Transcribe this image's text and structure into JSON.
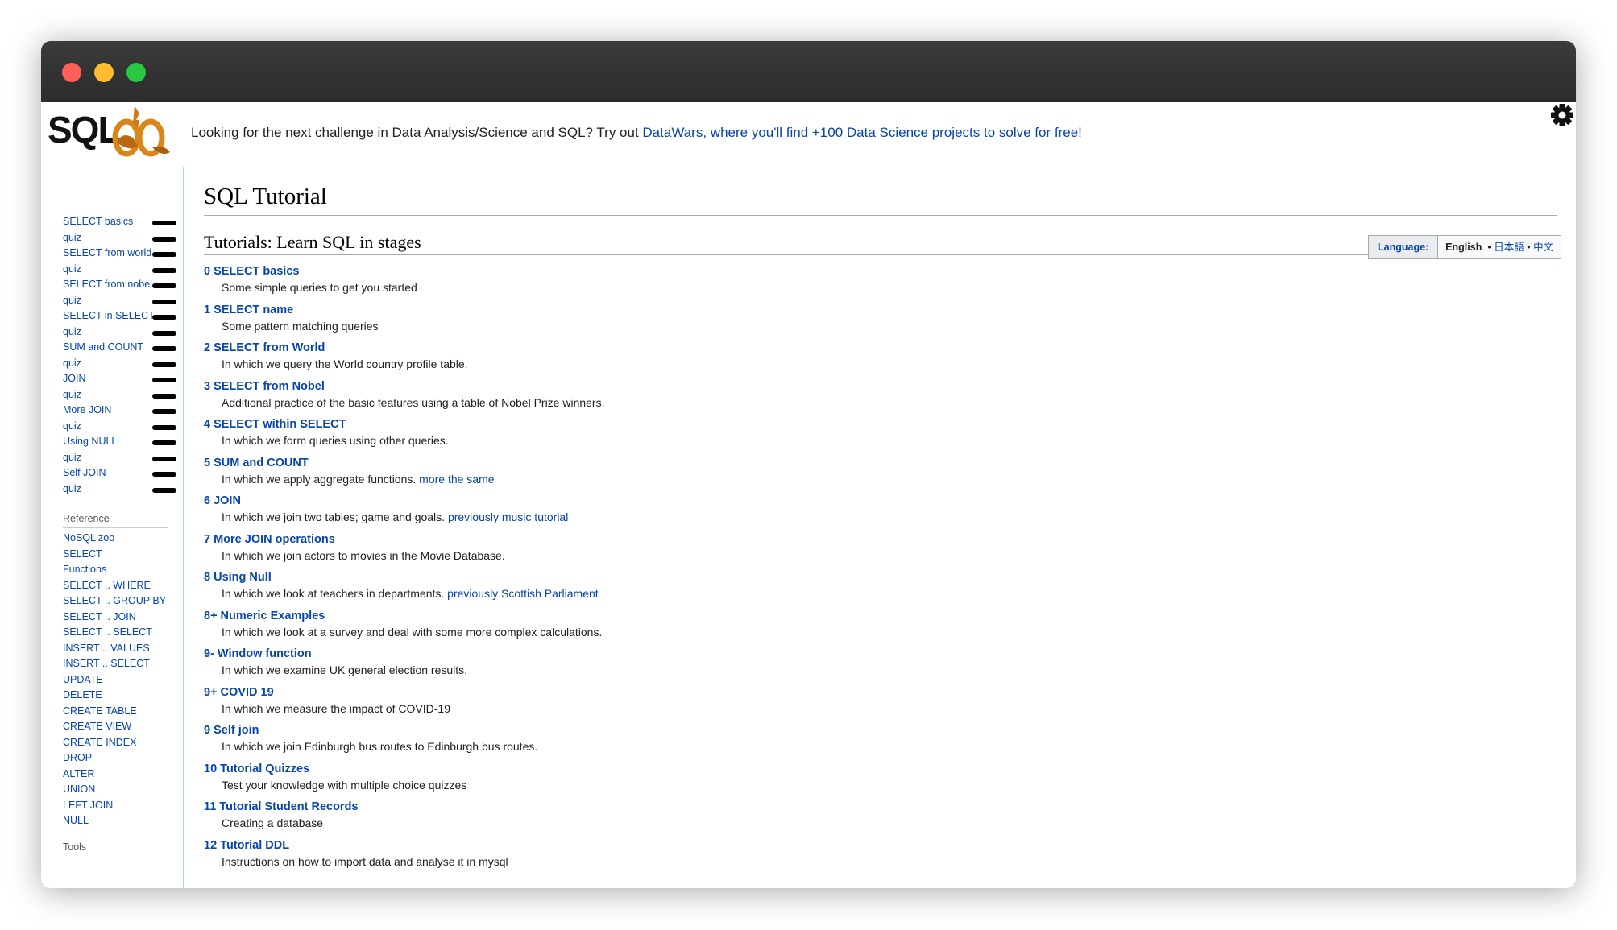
{
  "banner": {
    "text": "Looking for the next challenge in Data Analysis/Science and SQL? Try out ",
    "link": "DataWars, where you'll find +100 Data Science projects to solve for free!"
  },
  "logo": {
    "text": "SQLZOO"
  },
  "sidebar": {
    "tutorials": [
      {
        "label": "SELECT basics"
      },
      {
        "label": "quiz"
      },
      {
        "label": "SELECT from world"
      },
      {
        "label": "quiz"
      },
      {
        "label": "SELECT from nobel"
      },
      {
        "label": "quiz"
      },
      {
        "label": "SELECT in SELECT"
      },
      {
        "label": "quiz"
      },
      {
        "label": "SUM and COUNT"
      },
      {
        "label": "quiz"
      },
      {
        "label": "JOIN"
      },
      {
        "label": "quiz"
      },
      {
        "label": "More JOIN"
      },
      {
        "label": "quiz"
      },
      {
        "label": "Using NULL"
      },
      {
        "label": "quiz"
      },
      {
        "label": "Self JOIN"
      },
      {
        "label": "quiz"
      }
    ],
    "reference_heading": "Reference",
    "reference": [
      "NoSQL zoo",
      "SELECT",
      "Functions",
      "SELECT .. WHERE",
      "SELECT .. GROUP BY",
      "SELECT .. JOIN",
      "SELECT .. SELECT",
      "INSERT .. VALUES",
      "INSERT .. SELECT",
      "UPDATE",
      "DELETE",
      "CREATE TABLE",
      "CREATE VIEW",
      "CREATE INDEX",
      "DROP",
      "ALTER",
      "UNION",
      "LEFT JOIN",
      "NULL"
    ],
    "tools_heading": "Tools"
  },
  "main": {
    "title": "SQL Tutorial",
    "subtitle": "Tutorials: Learn SQL in stages",
    "language": {
      "label": "Language:",
      "current": "English",
      "sep": "•",
      "options": [
        "日本語",
        "中文"
      ]
    },
    "tutorials": [
      {
        "title": "0 SELECT basics",
        "desc": "Some simple queries to get you started",
        "extra": ""
      },
      {
        "title": "1 SELECT name",
        "desc": "Some pattern matching queries",
        "extra": ""
      },
      {
        "title": "2 SELECT from World",
        "desc": "In which we query the World country profile table.",
        "extra": ""
      },
      {
        "title": "3 SELECT from Nobel",
        "desc": "Additional practice of the basic features using a table of Nobel Prize winners.",
        "extra": ""
      },
      {
        "title": "4 SELECT within SELECT",
        "desc": "In which we form queries using other queries.",
        "extra": ""
      },
      {
        "title": "5 SUM and COUNT",
        "desc": "In which we apply aggregate functions. ",
        "extra": "more the same"
      },
      {
        "title": "6 JOIN",
        "desc": "In which we join two tables; game and goals. ",
        "extra": "previously music tutorial"
      },
      {
        "title": "7 More JOIN operations",
        "desc": "In which we join actors to movies in the Movie Database.",
        "extra": ""
      },
      {
        "title": "8 Using Null",
        "desc": "In which we look at teachers in departments. ",
        "extra": "previously Scottish Parliament"
      },
      {
        "title": "8+ Numeric Examples",
        "desc": "In which we look at a survey and deal with some more complex calculations.",
        "extra": ""
      },
      {
        "title": "9- Window function",
        "desc": "In which we examine UK general election results.",
        "extra": ""
      },
      {
        "title": "9+ COVID 19",
        "desc": "In which we measure the impact of COVID-19",
        "extra": ""
      },
      {
        "title": "9 Self join",
        "desc": "In which we join Edinburgh bus routes to Edinburgh bus routes.",
        "extra": ""
      },
      {
        "title": "10 Tutorial Quizzes",
        "desc": "Test your knowledge with multiple choice quizzes",
        "extra": ""
      },
      {
        "title": "11 Tutorial Student Records",
        "desc": "Creating a database",
        "extra": ""
      },
      {
        "title": "12 Tutorial DDL",
        "desc": "Instructions on how to import data and analyse it in mysql",
        "extra": ""
      }
    ]
  },
  "icons": {
    "settings": "gear-icon"
  },
  "colors": {
    "link": "#0645ad",
    "titlebar": "#2c2c2c",
    "progress_bar": "#000000"
  }
}
